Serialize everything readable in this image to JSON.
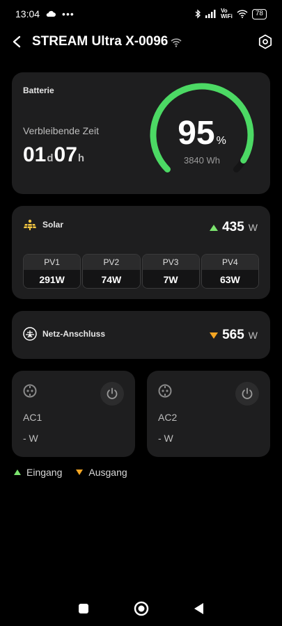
{
  "status": {
    "time": "13:04",
    "battery": "78",
    "vowifi_top": "Vo",
    "vowifi_bottom": "WiFi"
  },
  "header": {
    "title": "STREAM Ultra X-0096"
  },
  "battery": {
    "title": "Batterie",
    "remaining_label": "Verbleibende Zeit",
    "days": "01",
    "days_unit": "d",
    "hours": "07",
    "hours_unit": "h",
    "percent": "95",
    "percent_unit": "%",
    "percent_level": 95,
    "capacity": "3840 Wh"
  },
  "solar": {
    "label": "Solar",
    "value": "435",
    "unit": "W",
    "pv": [
      {
        "name": "PV1",
        "value": "291W"
      },
      {
        "name": "PV2",
        "value": "74W"
      },
      {
        "name": "PV3",
        "value": "7W"
      },
      {
        "name": "PV4",
        "value": "63W"
      }
    ]
  },
  "grid": {
    "label": "Netz-Anschluss",
    "value": "565",
    "unit": "W"
  },
  "ac": [
    {
      "name": "AC1",
      "value": "- W"
    },
    {
      "name": "AC2",
      "value": "- W"
    }
  ],
  "legend": {
    "input": "Eingang",
    "output": "Ausgang"
  },
  "colors": {
    "accent_green": "#4cd964",
    "input_arrow": "#7be36e",
    "output_arrow": "#f5a623",
    "card_bg": "#1e1e1f"
  },
  "icons": {
    "back": "back-arrow-icon",
    "settings": "hex-settings-icon",
    "solar": "solar-panel-icon",
    "grid": "grid-plug-icon",
    "socket": "socket-icon",
    "power": "power-icon"
  }
}
